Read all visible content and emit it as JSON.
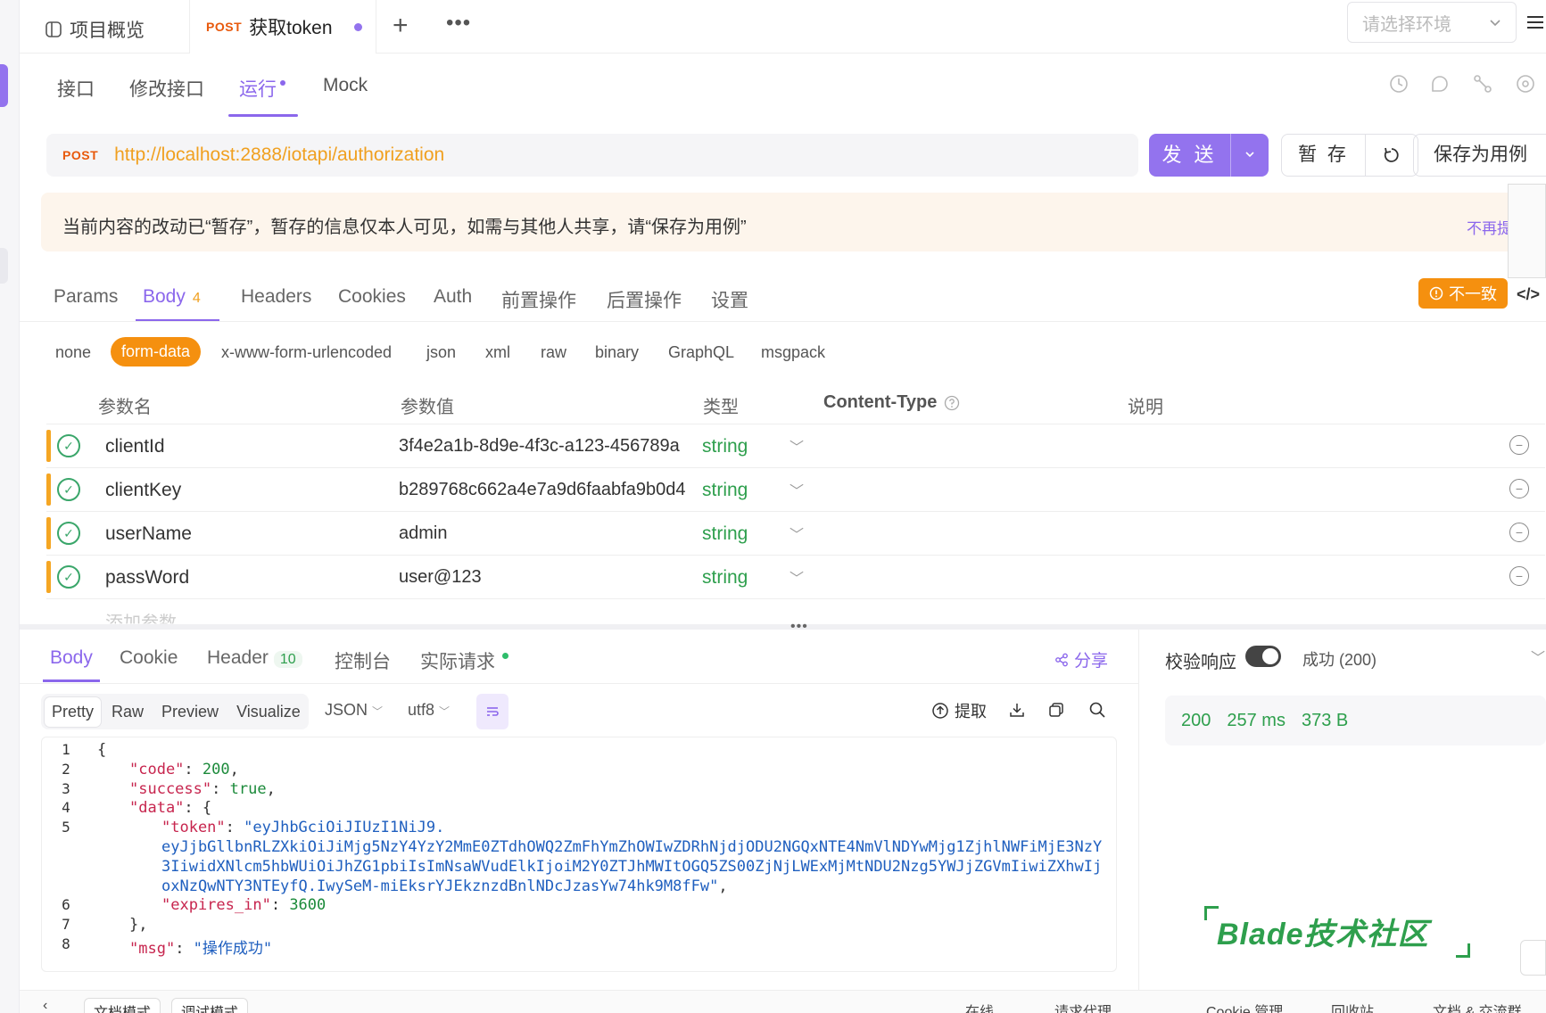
{
  "tabs": {
    "overview": "项目概览",
    "active_method": "POST",
    "active_title": "获取token",
    "plus": "+",
    "more": "•••"
  },
  "env": {
    "placeholder": "请选择环境"
  },
  "subtabs": {
    "items": [
      "接口",
      "修改接口",
      "运行",
      "Mock"
    ],
    "active": "运行"
  },
  "request": {
    "method": "POST",
    "url": "http://localhost:2888/iotapi/authorization",
    "send": "发 送",
    "save_temp": "暂 存",
    "save_case": "保存为用例"
  },
  "notice": {
    "text": "当前内容的改动已“暂存”，暂存的信息仅本人可见，如需与其他人共享，请“保存为用例”",
    "dismiss": "不再提"
  },
  "req_tabs": {
    "items": [
      "Params",
      "Body",
      "Headers",
      "Cookies",
      "Auth",
      "前置操作",
      "后置操作",
      "设置"
    ],
    "body_count": "4",
    "mismatch": "不一致",
    "code_toggle": "</>"
  },
  "body_types": [
    "none",
    "form-data",
    "x-www-form-urlencoded",
    "json",
    "xml",
    "raw",
    "binary",
    "GraphQL",
    "msgpack"
  ],
  "table": {
    "headers": {
      "name": "参数名",
      "value": "参数值",
      "type": "类型",
      "content_type": "Content-Type",
      "desc": "说明"
    },
    "rows": [
      {
        "name": "clientId",
        "value": "3f4e2a1b-8d9e-4f3c-a123-456789a",
        "type": "string"
      },
      {
        "name": "clientKey",
        "value": "b289768c662a4e7a9d6faabfa9b0d4",
        "type": "string"
      },
      {
        "name": "userName",
        "value": "admin",
        "type": "string"
      },
      {
        "name": "passWord",
        "value": "user@123",
        "type": "string"
      }
    ],
    "add": "添加参数"
  },
  "response": {
    "tabs": [
      "Body",
      "Cookie",
      "Header",
      "控制台",
      "实际请求"
    ],
    "header_count": "10",
    "share": "分享",
    "view_modes": [
      "Pretty",
      "Raw",
      "Preview",
      "Visualize"
    ],
    "format": "JSON",
    "encoding": "utf8",
    "extract": "提取",
    "lines": [
      {
        "no": "1",
        "indent": 0,
        "parts": [
          [
            "p",
            "{"
          ]
        ]
      },
      {
        "no": "2",
        "indent": 1,
        "parts": [
          [
            "k",
            "\"code\""
          ],
          [
            "p",
            ": "
          ],
          [
            "n",
            "200"
          ],
          [
            "p",
            ","
          ]
        ]
      },
      {
        "no": "3",
        "indent": 1,
        "parts": [
          [
            "k",
            "\"success\""
          ],
          [
            "p",
            ": "
          ],
          [
            "b",
            "true"
          ],
          [
            "p",
            ","
          ]
        ]
      },
      {
        "no": "4",
        "indent": 1,
        "parts": [
          [
            "k",
            "\"data\""
          ],
          [
            "p",
            ": {"
          ]
        ]
      },
      {
        "no": "5",
        "indent": 2,
        "parts": [
          [
            "k",
            "\"token\""
          ],
          [
            "p",
            ": "
          ],
          [
            "s",
            "\"eyJhbGciOiJIUzI1NiJ9."
          ]
        ]
      },
      {
        "no": "",
        "indent": 2,
        "parts": [
          [
            "s",
            "eyJjbGllbnRLZXkiOiJiMjg5NzY4YzY2MmE0ZTdhOWQ2ZmFhYmZhOWIwZDRhNjdjODU2NGQxNTE4NmVlNDYwMjg1ZjhlNWFiMjE3NzY"
          ]
        ]
      },
      {
        "no": "",
        "indent": 2,
        "parts": [
          [
            "s",
            "3IiwidXNlcm5hbWUiOiJhZG1pbiIsImNsaWVudElkIjoiM2Y0ZTJhMWItOGQ5ZS00ZjNjLWExMjMtNDU2Nzg5YWJjZGVmIiwiZXhwIj"
          ]
        ]
      },
      {
        "no": "",
        "indent": 2,
        "parts": [
          [
            "s",
            "oxNzQwNTY3NTEyfQ.IwySeM-miEksrYJEkznzdBnlNDcJzasYw74hk9M8fFw\""
          ],
          [
            "p",
            ","
          ]
        ]
      },
      {
        "no": "6",
        "indent": 2,
        "parts": [
          [
            "k",
            "\"expires_in\""
          ],
          [
            "p",
            ": "
          ],
          [
            "n",
            "3600"
          ]
        ]
      },
      {
        "no": "7",
        "indent": 1,
        "parts": [
          [
            "p",
            "},"
          ]
        ]
      },
      {
        "no": "8",
        "indent": 1,
        "parts": [
          [
            "k",
            "\"msg\""
          ],
          [
            "p",
            ": "
          ],
          [
            "s",
            "\"操作成功\""
          ]
        ]
      }
    ]
  },
  "verify": {
    "label": "校验响应",
    "value": "成功 (200)",
    "status": "200",
    "time": "257 ms",
    "size": "373 B"
  },
  "watermark": "Blade技术社区",
  "bottom": {
    "doc_mode": "文档模式",
    "debug_mode": "调试模式",
    "online": "在线",
    "proxy": "请求代理",
    "cookie": "Cookie 管理",
    "recycle": "回收站",
    "docs": "文档 & 交流群"
  },
  "colors": {
    "accent": "#9373ee",
    "orange": "#f5900f",
    "green": "#2e9f4d",
    "url": "#f0a020"
  }
}
